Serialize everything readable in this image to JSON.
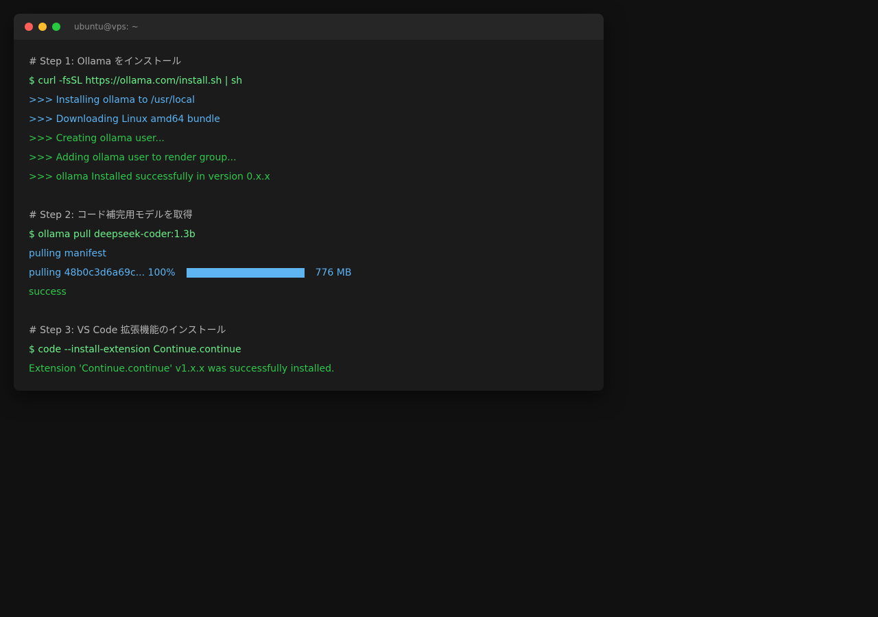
{
  "window": {
    "title": "ubuntu@vps: ~"
  },
  "step1": {
    "comment": "# Step 1: Ollama をインストール",
    "command": "$ curl -fsSL https://ollama.com/install.sh | sh",
    "out1": ">>> Installing ollama to /usr/local",
    "out2": ">>> Downloading Linux amd64 bundle",
    "out3": ">>> Creating ollama user...",
    "out4": ">>> Adding ollama user to render group...",
    "out5": ">>> ollama Installed successfully in version 0.x.x"
  },
  "step2": {
    "comment": "# Step 2: コード補完用モデルを取得",
    "command": "$ ollama pull deepseek-coder:1.3b",
    "manifest": "pulling manifest",
    "layer": "pulling 48b0c3d6a69c... 100%",
    "progress": 1.0,
    "size": "776 MB",
    "result": "success"
  },
  "step3": {
    "comment": "# Step 3: VS Code 拡張機能のインストール",
    "command": "$ code --install-extension Continue.continue",
    "result": "Extension 'Continue.continue' v1.x.x was successfully installed."
  },
  "colors": {
    "comment": "#b5b5b5",
    "command": "#6cf08a",
    "info": "#5cb3f2",
    "success": "#2fc64b",
    "progress": "#5fb5f1"
  }
}
